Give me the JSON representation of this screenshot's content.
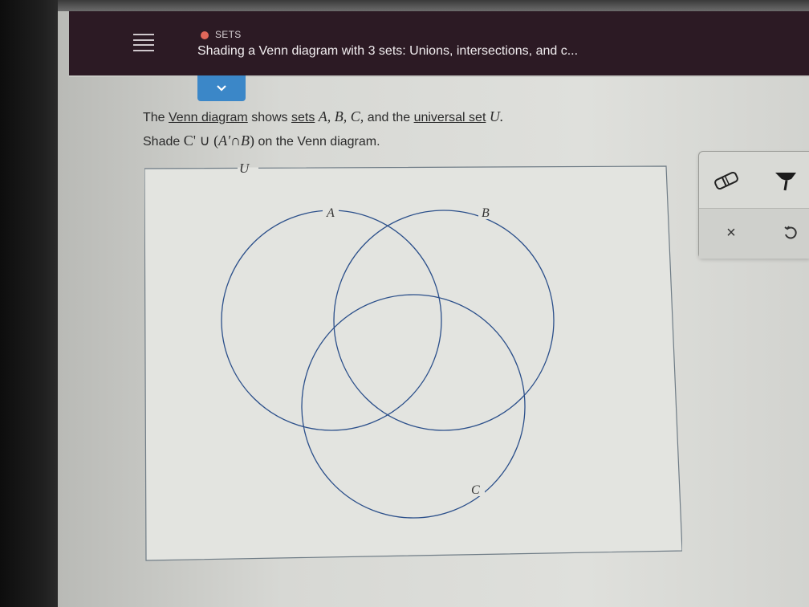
{
  "header": {
    "topic": "SETS",
    "title": "Shading a Venn diagram with 3 sets: Unions, intersections, and c..."
  },
  "problem": {
    "line1": {
      "t1": "The ",
      "venn_link": "Venn diagram",
      "t2": " shows ",
      "sets_link": "sets",
      "t3": " ",
      "vars": "A, B, C,",
      "t4": " and the ",
      "universal_link": "universal set",
      "t5": " ",
      "u": "U."
    },
    "line2": {
      "t1": "Shade ",
      "c_prime": "C'",
      "union": " ∪ (",
      "a_prime": "A'",
      "cap": "∩",
      "b": "B",
      "close": ")",
      "t2": " on the Venn diagram."
    }
  },
  "venn": {
    "universe_label": "U",
    "labels": {
      "a": "A",
      "b": "B",
      "c": "C"
    },
    "colors": {
      "circle": "#2b4f8a",
      "frame": "#6f7c86"
    }
  },
  "toolbox": {
    "eraser": "eraser-icon",
    "fill": "paint-icon",
    "clear": "×",
    "undo": "undo-icon"
  },
  "colors": {
    "header_bg": "#2c1a24",
    "accent": "#3b87c8",
    "topic_dot": "#e0675a"
  }
}
